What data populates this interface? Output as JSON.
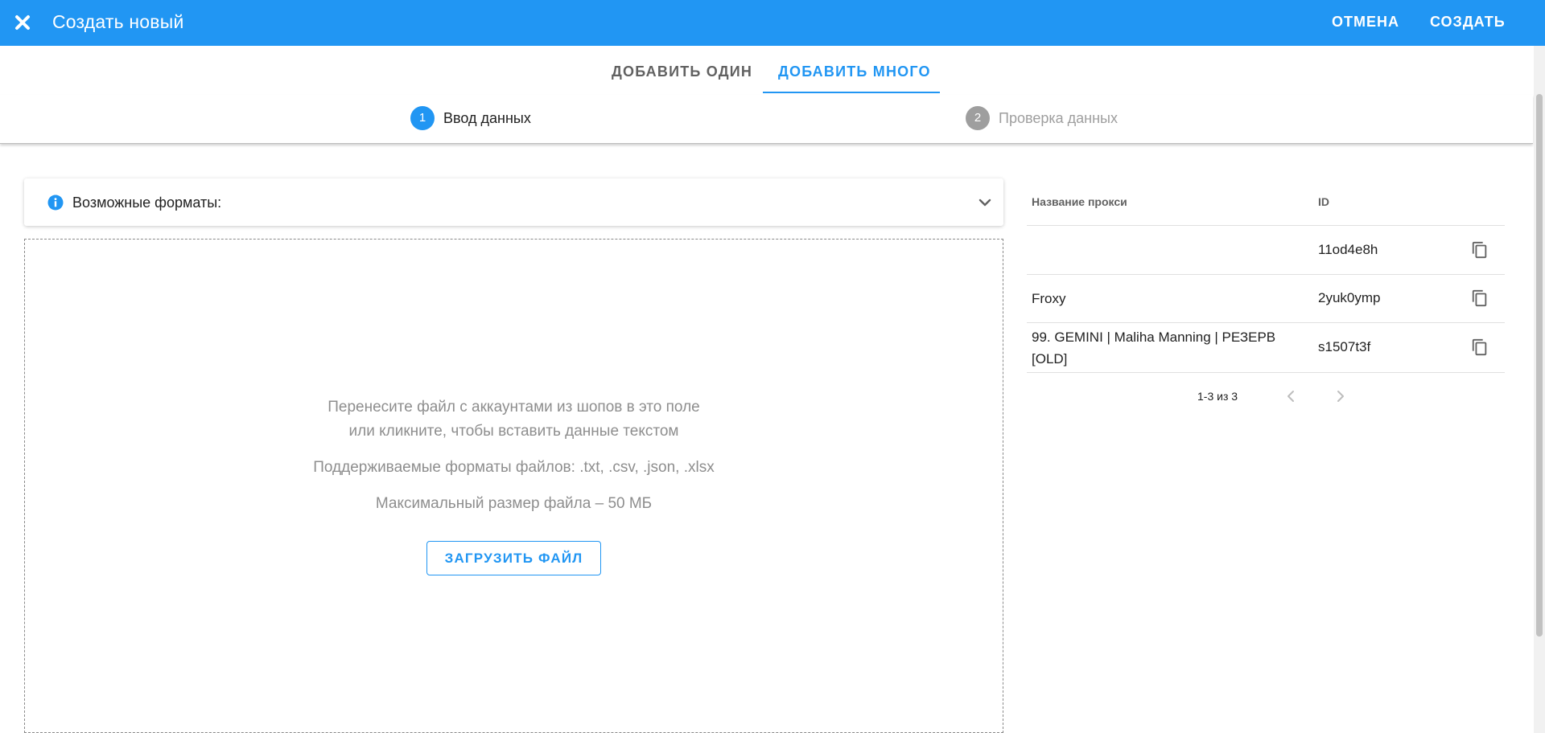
{
  "header": {
    "title": "Создать новый",
    "cancel_label": "ОТМЕНА",
    "create_label": "СОЗДАТЬ",
    "close_icon": "close-icon"
  },
  "tabs": {
    "add_one": "ДОБАВИТЬ ОДИН",
    "add_many": "ДОБАВИТЬ МНОГО",
    "active": "add_many"
  },
  "stepper": {
    "steps": [
      {
        "number": "1",
        "label": "Ввод данных",
        "active": true
      },
      {
        "number": "2",
        "label": "Проверка данных",
        "active": false
      }
    ]
  },
  "formats_panel": {
    "label": "Возможные форматы:",
    "info_icon": "info-icon",
    "expand_icon": "chevron-down-icon"
  },
  "dropzone": {
    "line1": "Перенесите файл с аккаунтами из шопов в это поле",
    "line2": "или кликните, чтобы вставить данные текстом",
    "formats": "Поддерживаемые форматы файлов: .txt, .csv, .json, .xlsx",
    "max_size": "Максимальный размер файла – 50 МБ",
    "upload_label": "ЗАГРУЗИТЬ ФАЙЛ"
  },
  "proxy_table": {
    "columns": [
      "Название прокси",
      "ID"
    ],
    "rows": [
      {
        "name": "",
        "id": "11od4e8h"
      },
      {
        "name": "Froxy",
        "id": "2yuk0ymp"
      },
      {
        "name": "99. GEMINI | Maliha Manning | РЕЗЕРВ [OLD]",
        "id": "s1507t3f"
      }
    ],
    "copy_icon": "copy-icon",
    "pagination": "1-3 из 3"
  },
  "colors": {
    "primary": "#2196f3",
    "inactive_tab": "#616161",
    "muted_text": "#8e8e8e",
    "inactive_step": "#9e9e9e"
  }
}
